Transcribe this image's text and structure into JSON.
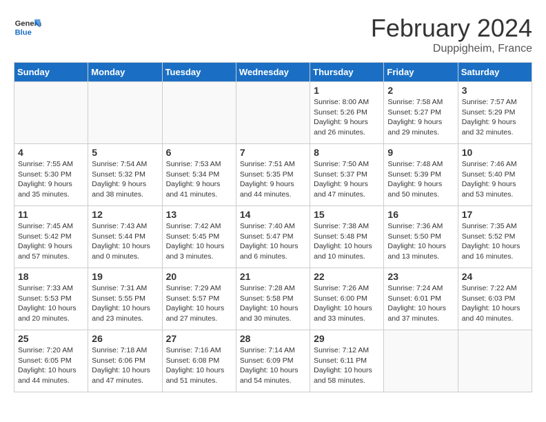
{
  "header": {
    "logo_general": "General",
    "logo_blue": "Blue",
    "month_title": "February 2024",
    "location": "Duppigheim, France"
  },
  "columns": [
    "Sunday",
    "Monday",
    "Tuesday",
    "Wednesday",
    "Thursday",
    "Friday",
    "Saturday"
  ],
  "weeks": [
    [
      {
        "day": "",
        "info": ""
      },
      {
        "day": "",
        "info": ""
      },
      {
        "day": "",
        "info": ""
      },
      {
        "day": "",
        "info": ""
      },
      {
        "day": "1",
        "info": "Sunrise: 8:00 AM\nSunset: 5:26 PM\nDaylight: 9 hours\nand 26 minutes."
      },
      {
        "day": "2",
        "info": "Sunrise: 7:58 AM\nSunset: 5:27 PM\nDaylight: 9 hours\nand 29 minutes."
      },
      {
        "day": "3",
        "info": "Sunrise: 7:57 AM\nSunset: 5:29 PM\nDaylight: 9 hours\nand 32 minutes."
      }
    ],
    [
      {
        "day": "4",
        "info": "Sunrise: 7:55 AM\nSunset: 5:30 PM\nDaylight: 9 hours\nand 35 minutes."
      },
      {
        "day": "5",
        "info": "Sunrise: 7:54 AM\nSunset: 5:32 PM\nDaylight: 9 hours\nand 38 minutes."
      },
      {
        "day": "6",
        "info": "Sunrise: 7:53 AM\nSunset: 5:34 PM\nDaylight: 9 hours\nand 41 minutes."
      },
      {
        "day": "7",
        "info": "Sunrise: 7:51 AM\nSunset: 5:35 PM\nDaylight: 9 hours\nand 44 minutes."
      },
      {
        "day": "8",
        "info": "Sunrise: 7:50 AM\nSunset: 5:37 PM\nDaylight: 9 hours\nand 47 minutes."
      },
      {
        "day": "9",
        "info": "Sunrise: 7:48 AM\nSunset: 5:39 PM\nDaylight: 9 hours\nand 50 minutes."
      },
      {
        "day": "10",
        "info": "Sunrise: 7:46 AM\nSunset: 5:40 PM\nDaylight: 9 hours\nand 53 minutes."
      }
    ],
    [
      {
        "day": "11",
        "info": "Sunrise: 7:45 AM\nSunset: 5:42 PM\nDaylight: 9 hours\nand 57 minutes."
      },
      {
        "day": "12",
        "info": "Sunrise: 7:43 AM\nSunset: 5:44 PM\nDaylight: 10 hours\nand 0 minutes."
      },
      {
        "day": "13",
        "info": "Sunrise: 7:42 AM\nSunset: 5:45 PM\nDaylight: 10 hours\nand 3 minutes."
      },
      {
        "day": "14",
        "info": "Sunrise: 7:40 AM\nSunset: 5:47 PM\nDaylight: 10 hours\nand 6 minutes."
      },
      {
        "day": "15",
        "info": "Sunrise: 7:38 AM\nSunset: 5:48 PM\nDaylight: 10 hours\nand 10 minutes."
      },
      {
        "day": "16",
        "info": "Sunrise: 7:36 AM\nSunset: 5:50 PM\nDaylight: 10 hours\nand 13 minutes."
      },
      {
        "day": "17",
        "info": "Sunrise: 7:35 AM\nSunset: 5:52 PM\nDaylight: 10 hours\nand 16 minutes."
      }
    ],
    [
      {
        "day": "18",
        "info": "Sunrise: 7:33 AM\nSunset: 5:53 PM\nDaylight: 10 hours\nand 20 minutes."
      },
      {
        "day": "19",
        "info": "Sunrise: 7:31 AM\nSunset: 5:55 PM\nDaylight: 10 hours\nand 23 minutes."
      },
      {
        "day": "20",
        "info": "Sunrise: 7:29 AM\nSunset: 5:57 PM\nDaylight: 10 hours\nand 27 minutes."
      },
      {
        "day": "21",
        "info": "Sunrise: 7:28 AM\nSunset: 5:58 PM\nDaylight: 10 hours\nand 30 minutes."
      },
      {
        "day": "22",
        "info": "Sunrise: 7:26 AM\nSunset: 6:00 PM\nDaylight: 10 hours\nand 33 minutes."
      },
      {
        "day": "23",
        "info": "Sunrise: 7:24 AM\nSunset: 6:01 PM\nDaylight: 10 hours\nand 37 minutes."
      },
      {
        "day": "24",
        "info": "Sunrise: 7:22 AM\nSunset: 6:03 PM\nDaylight: 10 hours\nand 40 minutes."
      }
    ],
    [
      {
        "day": "25",
        "info": "Sunrise: 7:20 AM\nSunset: 6:05 PM\nDaylight: 10 hours\nand 44 minutes."
      },
      {
        "day": "26",
        "info": "Sunrise: 7:18 AM\nSunset: 6:06 PM\nDaylight: 10 hours\nand 47 minutes."
      },
      {
        "day": "27",
        "info": "Sunrise: 7:16 AM\nSunset: 6:08 PM\nDaylight: 10 hours\nand 51 minutes."
      },
      {
        "day": "28",
        "info": "Sunrise: 7:14 AM\nSunset: 6:09 PM\nDaylight: 10 hours\nand 54 minutes."
      },
      {
        "day": "29",
        "info": "Sunrise: 7:12 AM\nSunset: 6:11 PM\nDaylight: 10 hours\nand 58 minutes."
      },
      {
        "day": "",
        "info": ""
      },
      {
        "day": "",
        "info": ""
      }
    ]
  ]
}
